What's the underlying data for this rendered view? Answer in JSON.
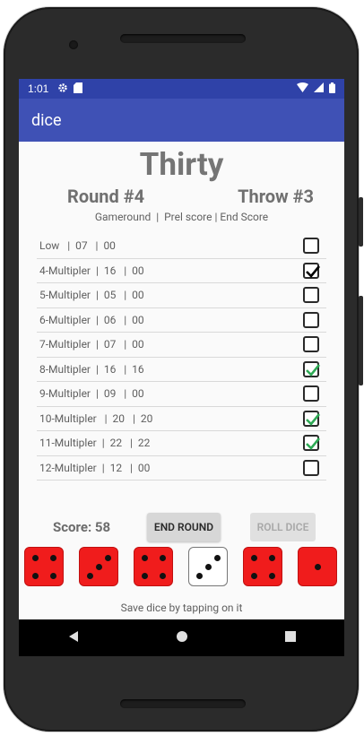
{
  "status": {
    "time": "1:01"
  },
  "appbar": {
    "title": "dice"
  },
  "game": {
    "title": "Thirty",
    "round": "Round #4",
    "throw": "Throw #3",
    "subheader": "Gameround  |  Prel score | End Score"
  },
  "rows": [
    {
      "text": "Low   |  07   |  00",
      "checked": false,
      "color": "#000000"
    },
    {
      "text": "4-Multipler  |  16   |  00",
      "checked": true,
      "color": "#000000"
    },
    {
      "text": "5-Multipler  |  05   |  00",
      "checked": false,
      "color": "#000000"
    },
    {
      "text": "6-Multipler  |  06   |  00",
      "checked": false,
      "color": "#000000"
    },
    {
      "text": "7-Multipler  |  07   |  00",
      "checked": false,
      "color": "#000000"
    },
    {
      "text": "8-Multipler  |  16   |  16",
      "checked": true,
      "color": "#2eaa55"
    },
    {
      "text": "9-Multipler  |  09   |  00",
      "checked": false,
      "color": "#000000"
    },
    {
      "text": "10-Multipler   |  20   |  20",
      "checked": true,
      "color": "#2eaa55"
    },
    {
      "text": "11-Multipler  |  22   |  22",
      "checked": true,
      "color": "#2eaa55"
    },
    {
      "text": "12-Multipler  |  12   |  00",
      "checked": false,
      "color": "#000000"
    }
  ],
  "score_label": "Score: 58",
  "end_round_label": "END ROUND",
  "roll_dice_label": "ROLL DICE",
  "dice": [
    {
      "value": 4,
      "saved": false
    },
    {
      "value": 3,
      "saved": false
    },
    {
      "value": 4,
      "saved": false
    },
    {
      "value": 3,
      "saved": true
    },
    {
      "value": 4,
      "saved": false
    },
    {
      "value": 1,
      "saved": false
    }
  ],
  "hint": "Save dice by tapping on it"
}
